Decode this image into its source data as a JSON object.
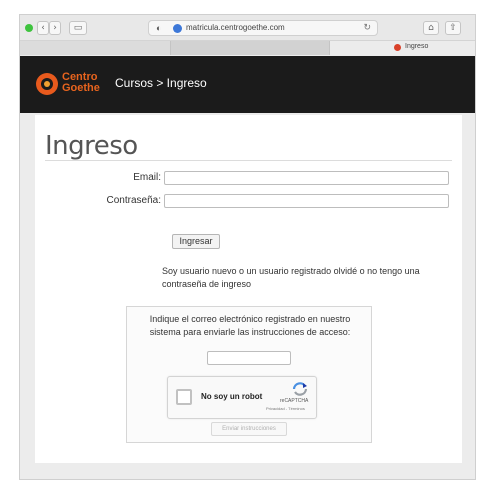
{
  "browser": {
    "url": "matricula.centrogoethe.com",
    "tab_title": "Ingreso",
    "back_glyph": "‹",
    "forward_glyph": "›",
    "sidebar_glyph": "▭",
    "shield_glyph": "◐",
    "reload_glyph": "↻",
    "home_glyph": "⌂",
    "share_glyph": "⇧"
  },
  "header": {
    "logo_line1": "Centro",
    "logo_line2": "Goethe",
    "breadcrumb": "Cursos > Ingreso",
    "brand_color": "#e8641e"
  },
  "login": {
    "title": "Ingreso",
    "email_label": "Email:",
    "password_label": "Contraseña:",
    "submit_label": "Ingresar",
    "help_text": "Soy usuario nuevo o un usuario registrado olvidé o no tengo una contraseña de ingreso"
  },
  "recover": {
    "instructions": "Indique el correo electrónico registrado en nuestro sistema para enviarle las instrucciones de acceso:",
    "captcha_label": "No soy un robot",
    "captcha_brand": "reCAPTCHA",
    "captcha_links": "Privacidad - Términos",
    "send_label": "Enviar instrucciones"
  }
}
